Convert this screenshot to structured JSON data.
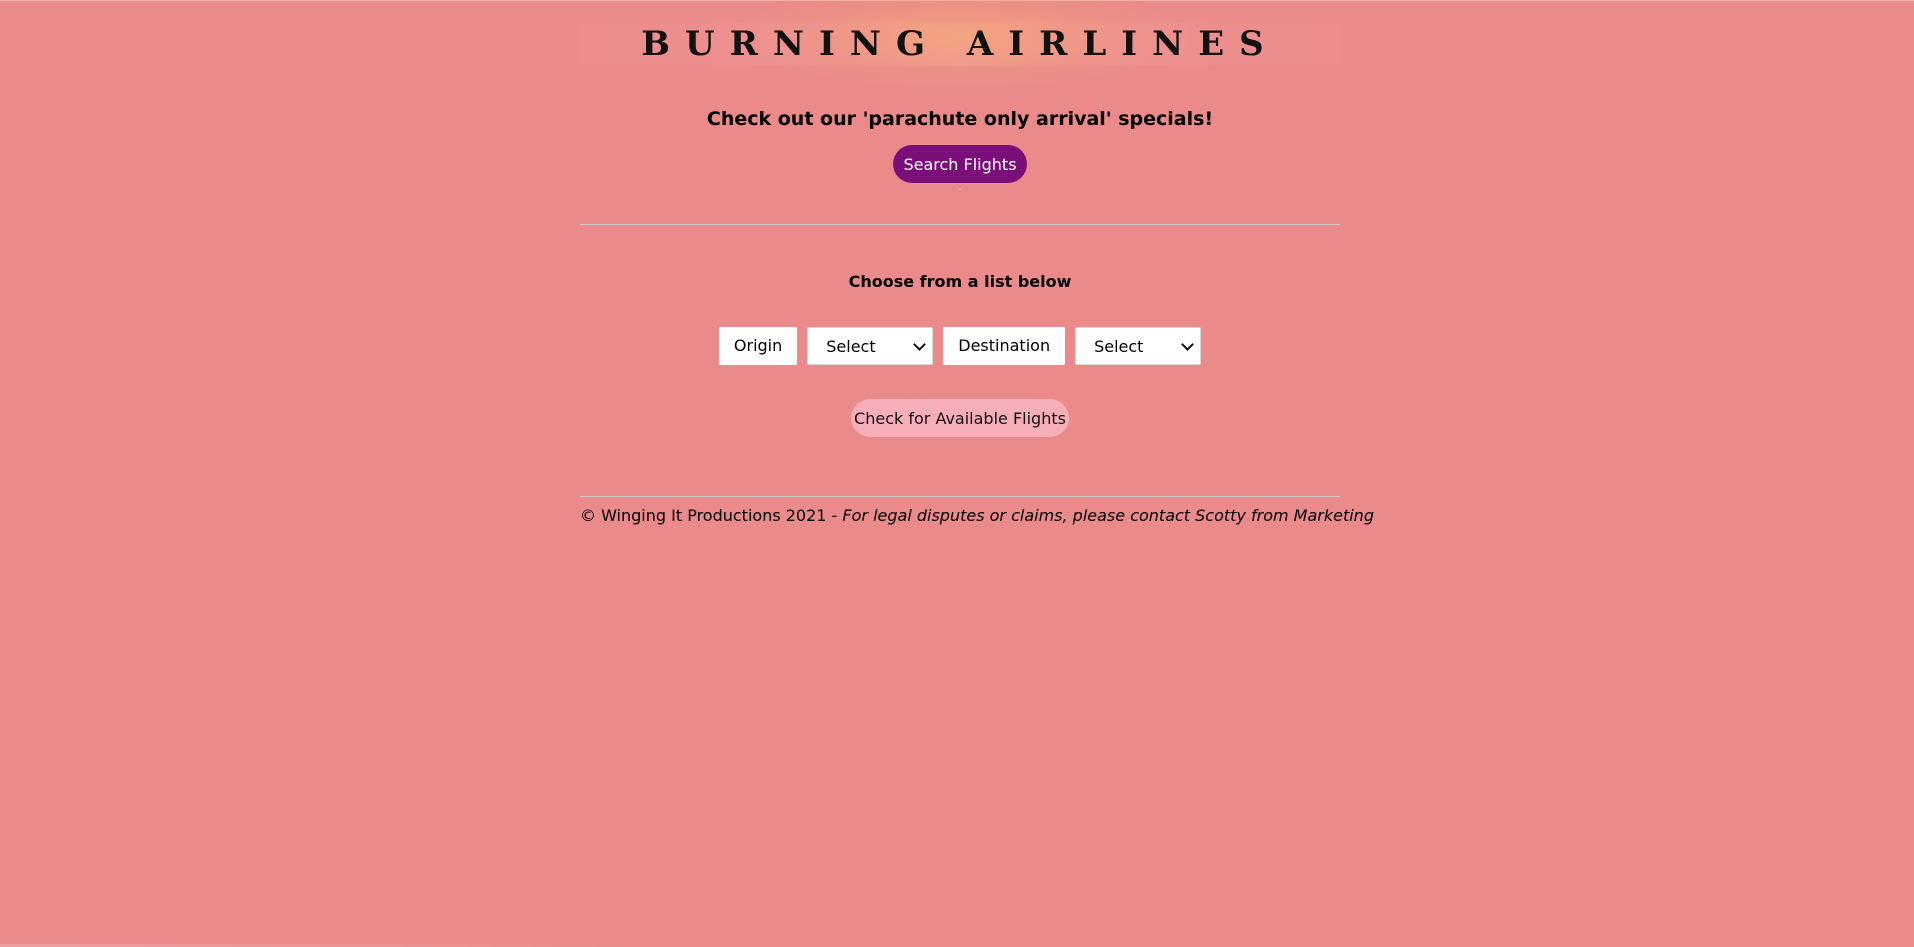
{
  "header": {
    "title": "BURNING AIRLINES"
  },
  "promo": {
    "text": "Check out our 'parachute only arrival' specials!",
    "search_button": "Search Flights"
  },
  "form": {
    "heading": "Choose from a list below",
    "origin_label": "Origin",
    "origin_select_value": "Select",
    "destination_label": "Destination",
    "destination_select_value": "Select",
    "check_button": "Check for Available Flights"
  },
  "footer": {
    "copyright": "© Winging It Productions 2021 -",
    "note": "For legal disputes or claims, please contact Scotty from Marketing"
  },
  "colors": {
    "background": "#ea8a8a",
    "search_button": "#7a0f7a",
    "check_button": "#f6aeb8"
  },
  "icons": {
    "select_arrow": "chevron-down-icon"
  }
}
